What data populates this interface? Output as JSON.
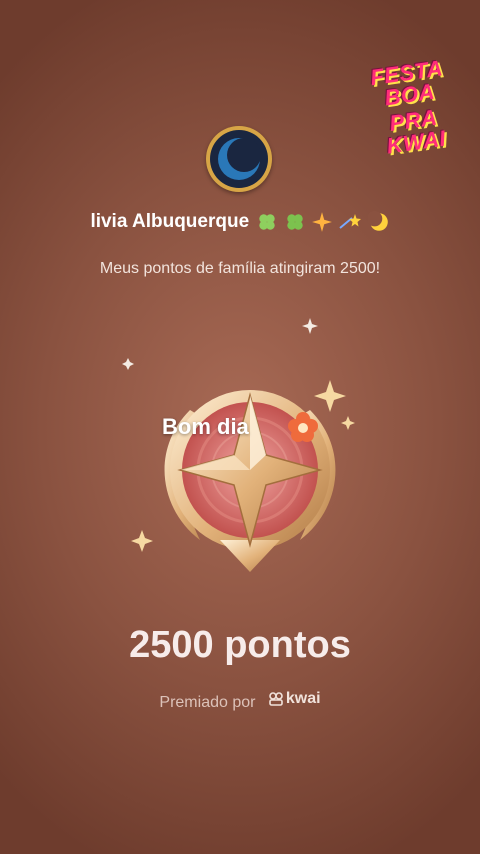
{
  "promo": {
    "line1": "FESTA BOA",
    "line2": "PRA KWAI"
  },
  "user": {
    "name": "livia Albuquerque",
    "avatar_icon": "crescent-moon-icon"
  },
  "message": "Meus pontos de família atingiram 2500!",
  "badge": {
    "caption": "Bom dia",
    "icon": "star-medal-icon"
  },
  "points": {
    "total": "2500 pontos"
  },
  "awarded": {
    "label": "Premiado por",
    "brand": "kwai"
  },
  "colors": {
    "background": "#8a5240",
    "accent_pink": "#ff2d7a",
    "gold": "#d7a546"
  }
}
